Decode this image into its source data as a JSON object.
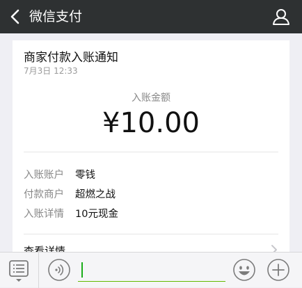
{
  "header": {
    "title": "微信支付",
    "back_icon": "chevron-left-icon",
    "profile_icon": "person-icon"
  },
  "card": {
    "title": "商家付款入账通知",
    "time": "7月3日  12:33",
    "amount_label": "入账金额",
    "amount": "¥10.00",
    "rows": [
      {
        "label": "入账账户",
        "value": "零钱"
      },
      {
        "label": "付款商户",
        "value": "超燃之战"
      },
      {
        "label": "入账详情",
        "value": "10元现金"
      }
    ],
    "view_details": "查看详情"
  },
  "toolbar": {
    "menu_icon": "list-menu-icon",
    "voice_icon": "voice-icon",
    "input_value": "",
    "emoji_icon": "emoji-icon",
    "plus_icon": "plus-icon"
  },
  "colors": {
    "nav_bg": "#2e3132",
    "page_bg": "#efeff4",
    "accent_green": "#1aad19"
  }
}
